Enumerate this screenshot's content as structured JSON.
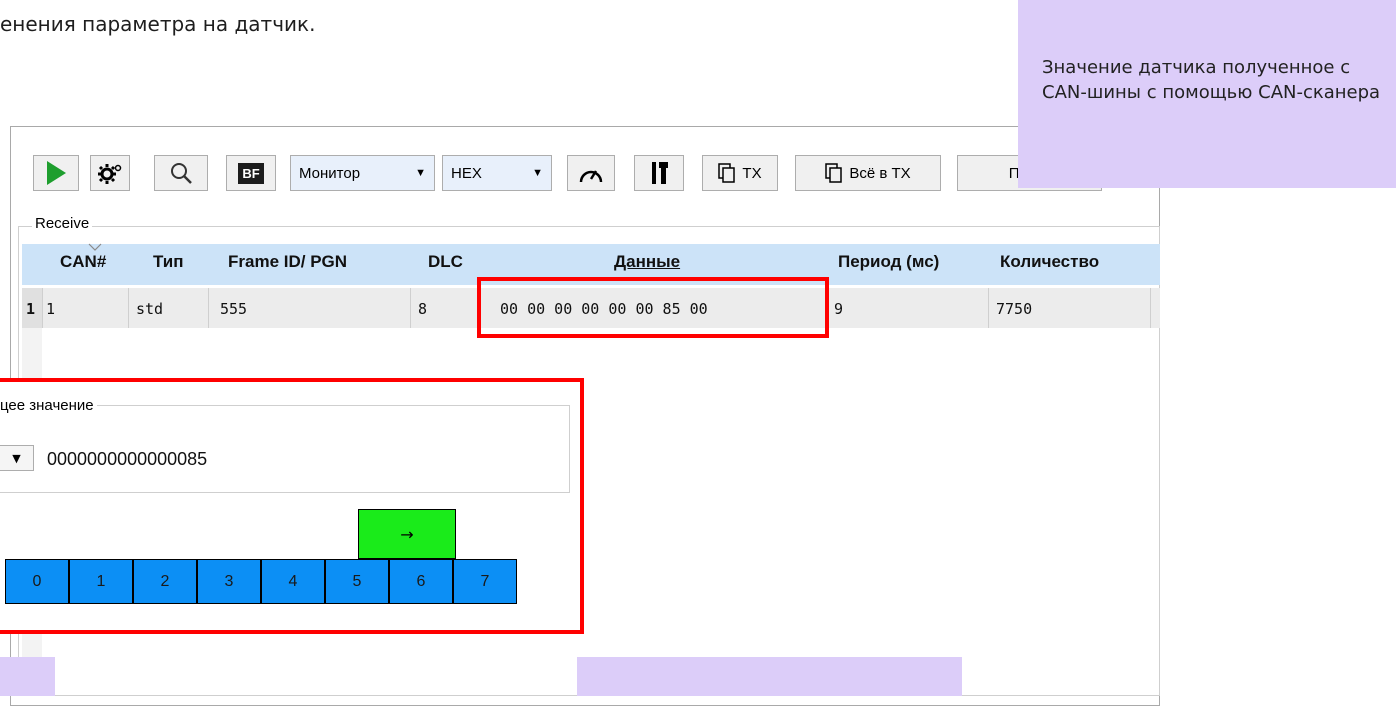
{
  "intro_text": "енения параметра на датчик.",
  "callouts": {
    "top_right": "Значение датчика полученное с CAN-шины с помощью CAN-сканера"
  },
  "toolbar": {
    "monitor_label": "Монитор",
    "hex_label": "HEX",
    "tx_label": "TX",
    "all_tx_label": "Всё в TX",
    "search_label": "Поиск",
    "bf_label": "BF"
  },
  "receive": {
    "title": "Receive",
    "columns": [
      "CAN#",
      "Тип",
      "Frame ID/ PGN",
      "DLC",
      "Данные",
      "Период (мс)",
      "Количество"
    ],
    "rows": [
      {
        "num": "1",
        "can": "1",
        "type": "std",
        "frame_id": "555",
        "dlc": "8",
        "data": "00 00 00 00 00 00 85 00",
        "period": "9",
        "count": "7750"
      }
    ]
  },
  "current_value": {
    "title": "цее значение",
    "value": "0000000000000085",
    "arrow_label": "→",
    "bytes": [
      "0",
      "1",
      "2",
      "3",
      "4",
      "5",
      "6",
      "7"
    ],
    "selected_bytes": [
      "5",
      "6"
    ]
  },
  "colors": {
    "callout": "#dccdf9",
    "table_header": "#cce3f8",
    "byte_cell": "#0c8ff5",
    "byte_selected": "#1aeb1a",
    "highlight_border": "#ff0000",
    "play_icon": "#1e9e2e"
  }
}
